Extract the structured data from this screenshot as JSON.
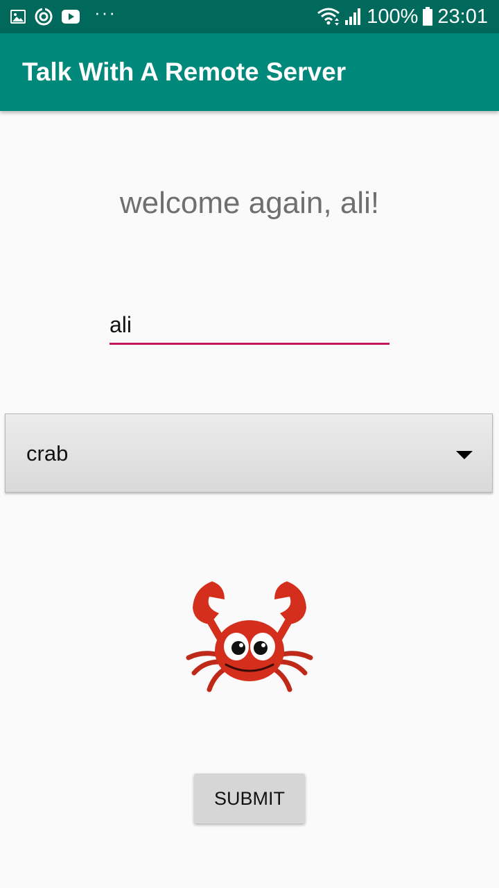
{
  "status_bar": {
    "battery": "100%",
    "time": "23:01",
    "overflow": "···",
    "icons": [
      "gallery-icon",
      "sync-icon",
      "youtube-icon",
      "wifi-icon",
      "signal-icon",
      "battery-icon"
    ]
  },
  "app_bar": {
    "title": "Talk With A Remote Server"
  },
  "main": {
    "welcome_text": "welcome again, ali!",
    "name_value": "ali",
    "spinner_selected": "crab",
    "image_icon": "crab-icon",
    "submit_label": "SUBMIT"
  },
  "colors": {
    "status_bar": "#00695c",
    "app_bar": "#00897b",
    "input_underline": "#c2185b",
    "crab_red": "#d32f1c"
  }
}
